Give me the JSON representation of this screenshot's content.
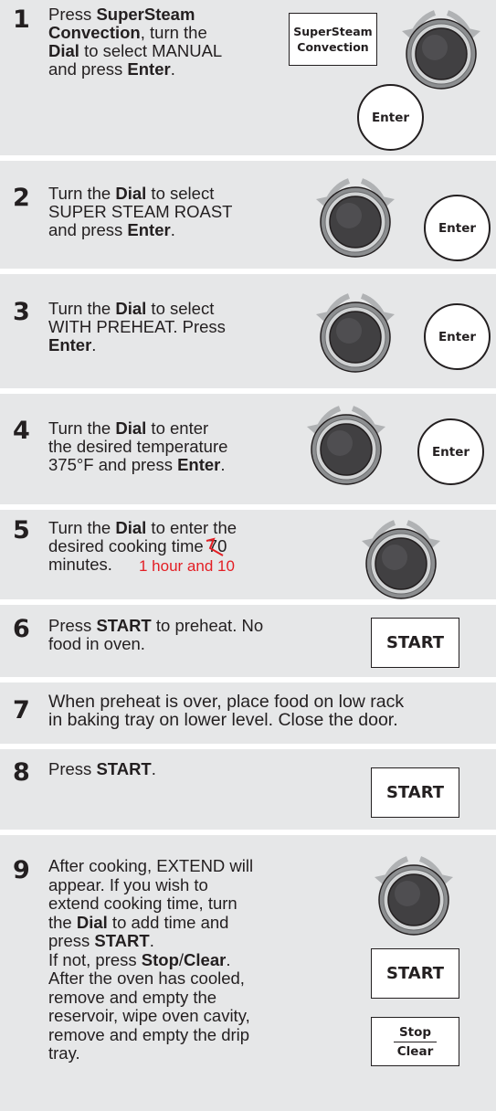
{
  "steps": [
    {
      "num": "1",
      "lines": [
        [
          "Press ",
          "b:SuperSteam"
        ],
        [
          "b:Convection",
          ", turn the"
        ],
        [
          "b:Dial",
          " to select MANUAL"
        ],
        [
          "and press ",
          "b:Enter",
          "."
        ]
      ],
      "buttons": {
        "supersteam_line1": "SuperSteam",
        "supersteam_line2": "Convection",
        "enter": "Enter"
      }
    },
    {
      "num": "2",
      "lines": [
        [
          "Turn the ",
          "b:Dial",
          " to select"
        ],
        [
          "SUPER STEAM ROAST"
        ],
        [
          "and press ",
          "b:Enter",
          "."
        ]
      ],
      "buttons": {
        "enter": "Enter"
      }
    },
    {
      "num": "3",
      "lines": [
        [
          "Turn the ",
          "b:Dial",
          " to select"
        ],
        [
          "WITH PREHEAT. Press"
        ],
        [
          "b:Enter",
          "."
        ]
      ],
      "buttons": {
        "enter": "Enter"
      }
    },
    {
      "num": "4",
      "lines": [
        [
          "Turn the ",
          "b:Dial",
          " to enter"
        ],
        [
          "the desired temperature"
        ],
        [
          "375°F and press ",
          "b:Enter",
          "."
        ]
      ],
      "buttons": {
        "enter": "Enter"
      }
    },
    {
      "num": "5",
      "lines": [
        [
          "Turn the ",
          "b:Dial",
          " to enter the"
        ],
        [
          "desired cooking time 70"
        ],
        [
          "minutes."
        ]
      ],
      "annotation": "1 hour and  10"
    },
    {
      "num": "6",
      "lines": [
        [
          "Press ",
          "b:START",
          " to preheat. No"
        ],
        [
          "food in oven."
        ]
      ],
      "buttons": {
        "start": "START"
      }
    },
    {
      "num": "7",
      "lines": [
        [
          "When preheat is over, place food on low rack"
        ],
        [
          "in baking tray on lower level. Close the door."
        ]
      ]
    },
    {
      "num": "8",
      "lines": [
        [
          "Press ",
          "b:START",
          "."
        ]
      ],
      "buttons": {
        "start": "START"
      }
    },
    {
      "num": "9",
      "lines": [
        [
          "After cooking, EXTEND will"
        ],
        [
          "appear. If you wish to"
        ],
        [
          "extend cooking time, turn"
        ],
        [
          "the ",
          "b:Dial",
          " to add time and"
        ],
        [
          "press ",
          "b:START",
          "."
        ],
        [
          "If not, press ",
          "b:Stop",
          "/",
          "b:Clear",
          "."
        ],
        [
          "After the oven has cooled,"
        ],
        [
          "remove and empty the"
        ],
        [
          "reservoir, wipe oven cavity,"
        ],
        [
          "remove and empty the drip"
        ],
        [
          "tray."
        ]
      ],
      "buttons": {
        "start": "START",
        "stop": "Stop",
        "clear": "Clear"
      }
    }
  ],
  "colors": {
    "background": "#e6e7e8",
    "text": "#231f20",
    "annotation": "#e31e24",
    "divider": "#ffffff"
  }
}
